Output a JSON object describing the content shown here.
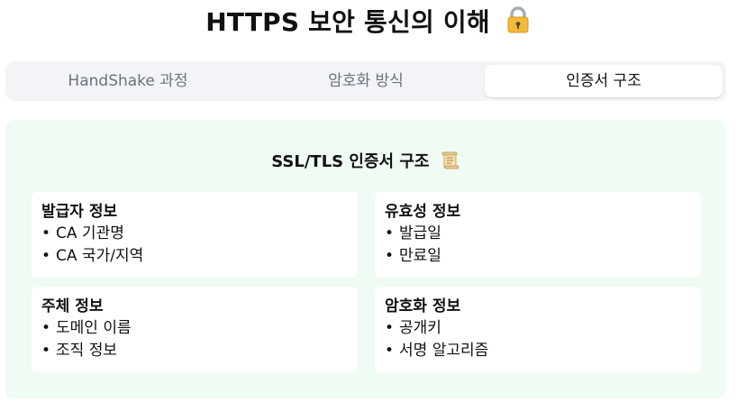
{
  "title": "HTTPS 보안 통신의 이해",
  "title_icon": "lock-icon",
  "tabs": [
    {
      "label": "HandShake 과정",
      "active": false
    },
    {
      "label": "암호화 방식",
      "active": false
    },
    {
      "label": "인증서 구조",
      "active": true
    }
  ],
  "panel": {
    "title": "SSL/TLS 인증서 구조",
    "title_icon": "scroll-icon",
    "background": "#f0fbf3",
    "cards": [
      {
        "heading": "발급자 정보",
        "items": [
          "CA 기관명",
          "CA 국가/지역"
        ]
      },
      {
        "heading": "유효성 정보",
        "items": [
          "발급일",
          "만료일"
        ]
      },
      {
        "heading": "주체 정보",
        "items": [
          "도메인 이름",
          "조직 정보"
        ]
      },
      {
        "heading": "암호화 정보",
        "items": [
          "공개키",
          "서명 알고리즘"
        ]
      }
    ]
  },
  "bullet_char": "•"
}
